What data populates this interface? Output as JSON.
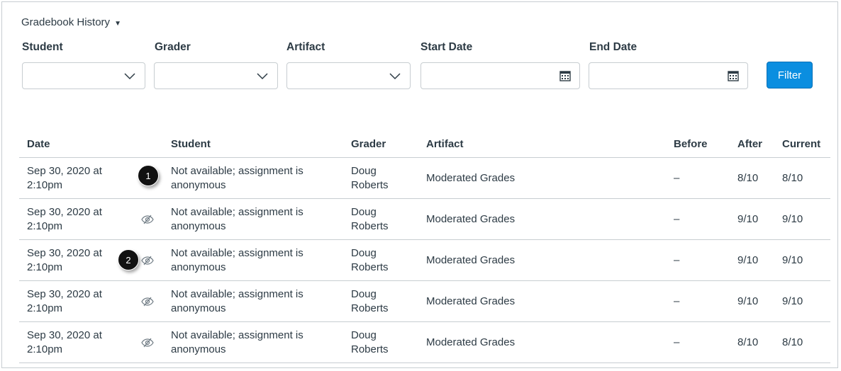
{
  "header": {
    "title": "Gradebook History"
  },
  "filters": {
    "student": "Student",
    "grader": "Grader",
    "artifact": "Artifact",
    "start_date": "Start Date",
    "end_date": "End Date",
    "filter_button": "Filter"
  },
  "table": {
    "columns": [
      "Date",
      "Student",
      "Grader",
      "Artifact",
      "Before",
      "After",
      "Current"
    ],
    "rows": [
      {
        "date": "Sep 30, 2020 at",
        "time": "2:10pm",
        "student1": "Not available; assignment is",
        "student2": "anonymous",
        "grader1": "Doug",
        "grader2": "Roberts",
        "artifact": "Moderated Grades",
        "before": "–",
        "after": "8/10",
        "current": "8/10"
      },
      {
        "date": "Sep 30, 2020 at",
        "time": "2:10pm",
        "student1": "Not available; assignment is",
        "student2": "anonymous",
        "grader1": "Doug",
        "grader2": "Roberts",
        "artifact": "Moderated Grades",
        "before": "–",
        "after": "9/10",
        "current": "9/10"
      },
      {
        "date": "Sep 30, 2020 at",
        "time": "2:10pm",
        "student1": "Not available; assignment is",
        "student2": "anonymous",
        "grader1": "Doug",
        "grader2": "Roberts",
        "artifact": "Moderated Grades",
        "before": "–",
        "after": "9/10",
        "current": "9/10"
      },
      {
        "date": "Sep 30, 2020 at",
        "time": "2:10pm",
        "student1": "Not available; assignment is",
        "student2": "anonymous",
        "grader1": "Doug",
        "grader2": "Roberts",
        "artifact": "Moderated Grades",
        "before": "–",
        "after": "9/10",
        "current": "9/10"
      },
      {
        "date": "Sep 30, 2020 at",
        "time": "2:10pm",
        "student1": "Not available; assignment is",
        "student2": "anonymous",
        "grader1": "Doug",
        "grader2": "Roberts",
        "artifact": "Moderated Grades",
        "before": "–",
        "after": "8/10",
        "current": "8/10"
      }
    ]
  },
  "callouts": [
    "1",
    "2"
  ]
}
